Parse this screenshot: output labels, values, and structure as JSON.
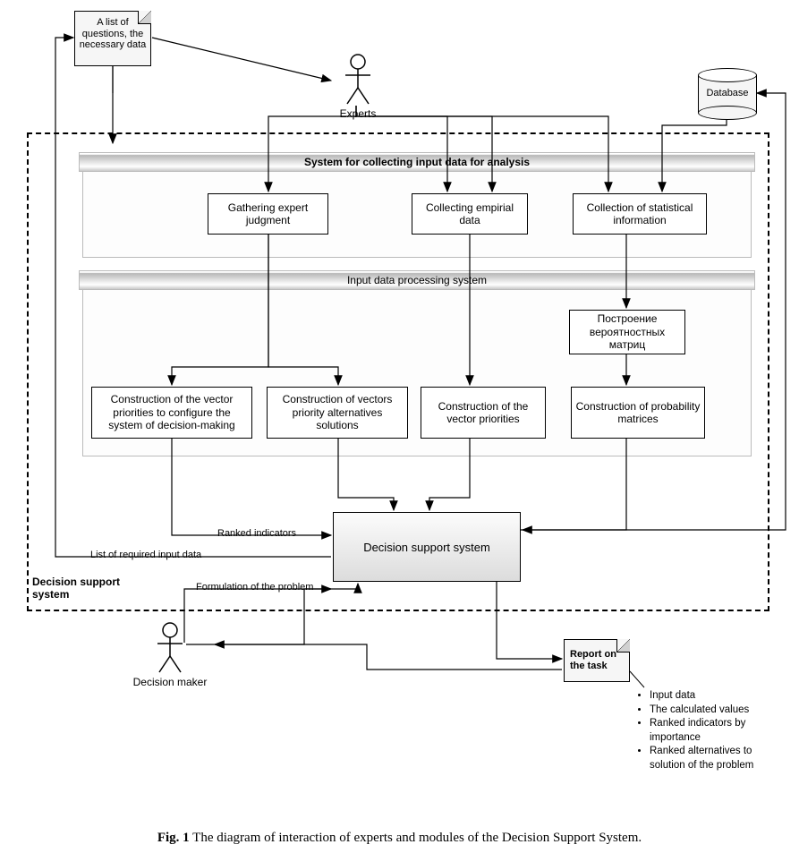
{
  "note_questions": "A list of questions, the necessary data",
  "actor_experts": "Experts",
  "actor_decision_maker": "Decision maker",
  "database": "Database",
  "section_input_collect": "System for collecting input data for analysis",
  "section_processing": "Input data processing system",
  "boxes": {
    "gather_expert": "Gathering expert judgment",
    "collect_empirical": "Collecting empirial data",
    "collect_stat": "Collection of statistical information",
    "prob_matrix_ru": "Построение вероятностных матриц",
    "vec_config": "Construction of the vector priorities to configure the system of decision-making",
    "vec_alt": "Construction of vectors priority alternatives solutions",
    "vec_prior": "Construction of the vector priorities",
    "prob_matrices": "Construction of probability matrices"
  },
  "dss_box": "Decision support system",
  "dss_frame_label": "Decision support system",
  "edge_labels": {
    "ranked_indicators": "Ranked indicators",
    "list_required": "List of required input data",
    "formulation": "Formulation of the problem"
  },
  "report_note": "Report on the task",
  "report_items": [
    "Input data",
    "The calculated values",
    "Ranked indicators by importance",
    "Ranked alternatives to solution of the problem"
  ],
  "caption_bold": "Fig. 1",
  "caption_text": " The diagram of interaction of experts and modules of the Decision Support System."
}
